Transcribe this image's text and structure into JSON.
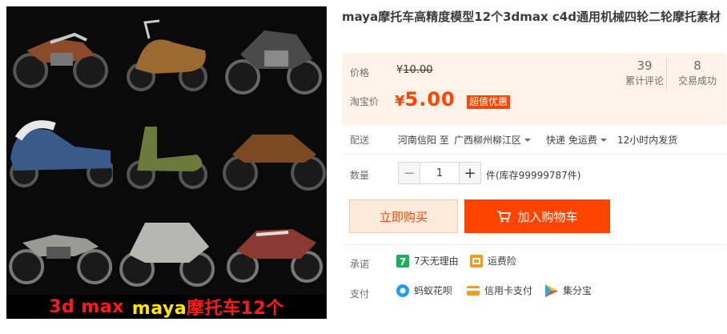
{
  "product": {
    "title": "maya摩托车高精度模型12个3dmax c4d通用机械四轮二轮摩托素材",
    "image_caption": {
      "part1": "3d max",
      "part2": "maya摩托车12个"
    }
  },
  "price": {
    "label": "价格",
    "original": "10.00",
    "currency": "¥",
    "promo_label": "淘宝价",
    "promo": "5.00",
    "badge": "超值优惠"
  },
  "stats": [
    {
      "value": "39",
      "label": "累计评论"
    },
    {
      "value": "8",
      "label": "交易成功"
    }
  ],
  "shipping": {
    "label": "配送",
    "from": "河南信阳 至",
    "to": "广西柳州柳江区",
    "method": "快递 免运费",
    "time": "12小时内发货"
  },
  "quantity": {
    "label": "数量",
    "value": "1",
    "minus": "−",
    "plus": "+",
    "stock_text": "件(库存99999787件)"
  },
  "actions": {
    "buy_now": "立即购买",
    "add_cart": "加入购物车"
  },
  "promise": {
    "label": "承诺",
    "items": [
      {
        "icon": "seven-day-return-icon",
        "text": "7天无理由"
      },
      {
        "icon": "shipping-insurance-icon",
        "text": "运费险"
      }
    ]
  },
  "payment": {
    "label": "支付",
    "items": [
      {
        "icon": "huabei-icon",
        "text": "蚂蚁花呗"
      },
      {
        "icon": "credit-card-icon",
        "text": "信用卡支付"
      },
      {
        "icon": "jifenbao-icon",
        "text": "集分宝"
      }
    ]
  },
  "colors": {
    "accent": "#ff4400",
    "price_bg": "#fff2e8",
    "buy_now_bg": "#ffeadc"
  }
}
